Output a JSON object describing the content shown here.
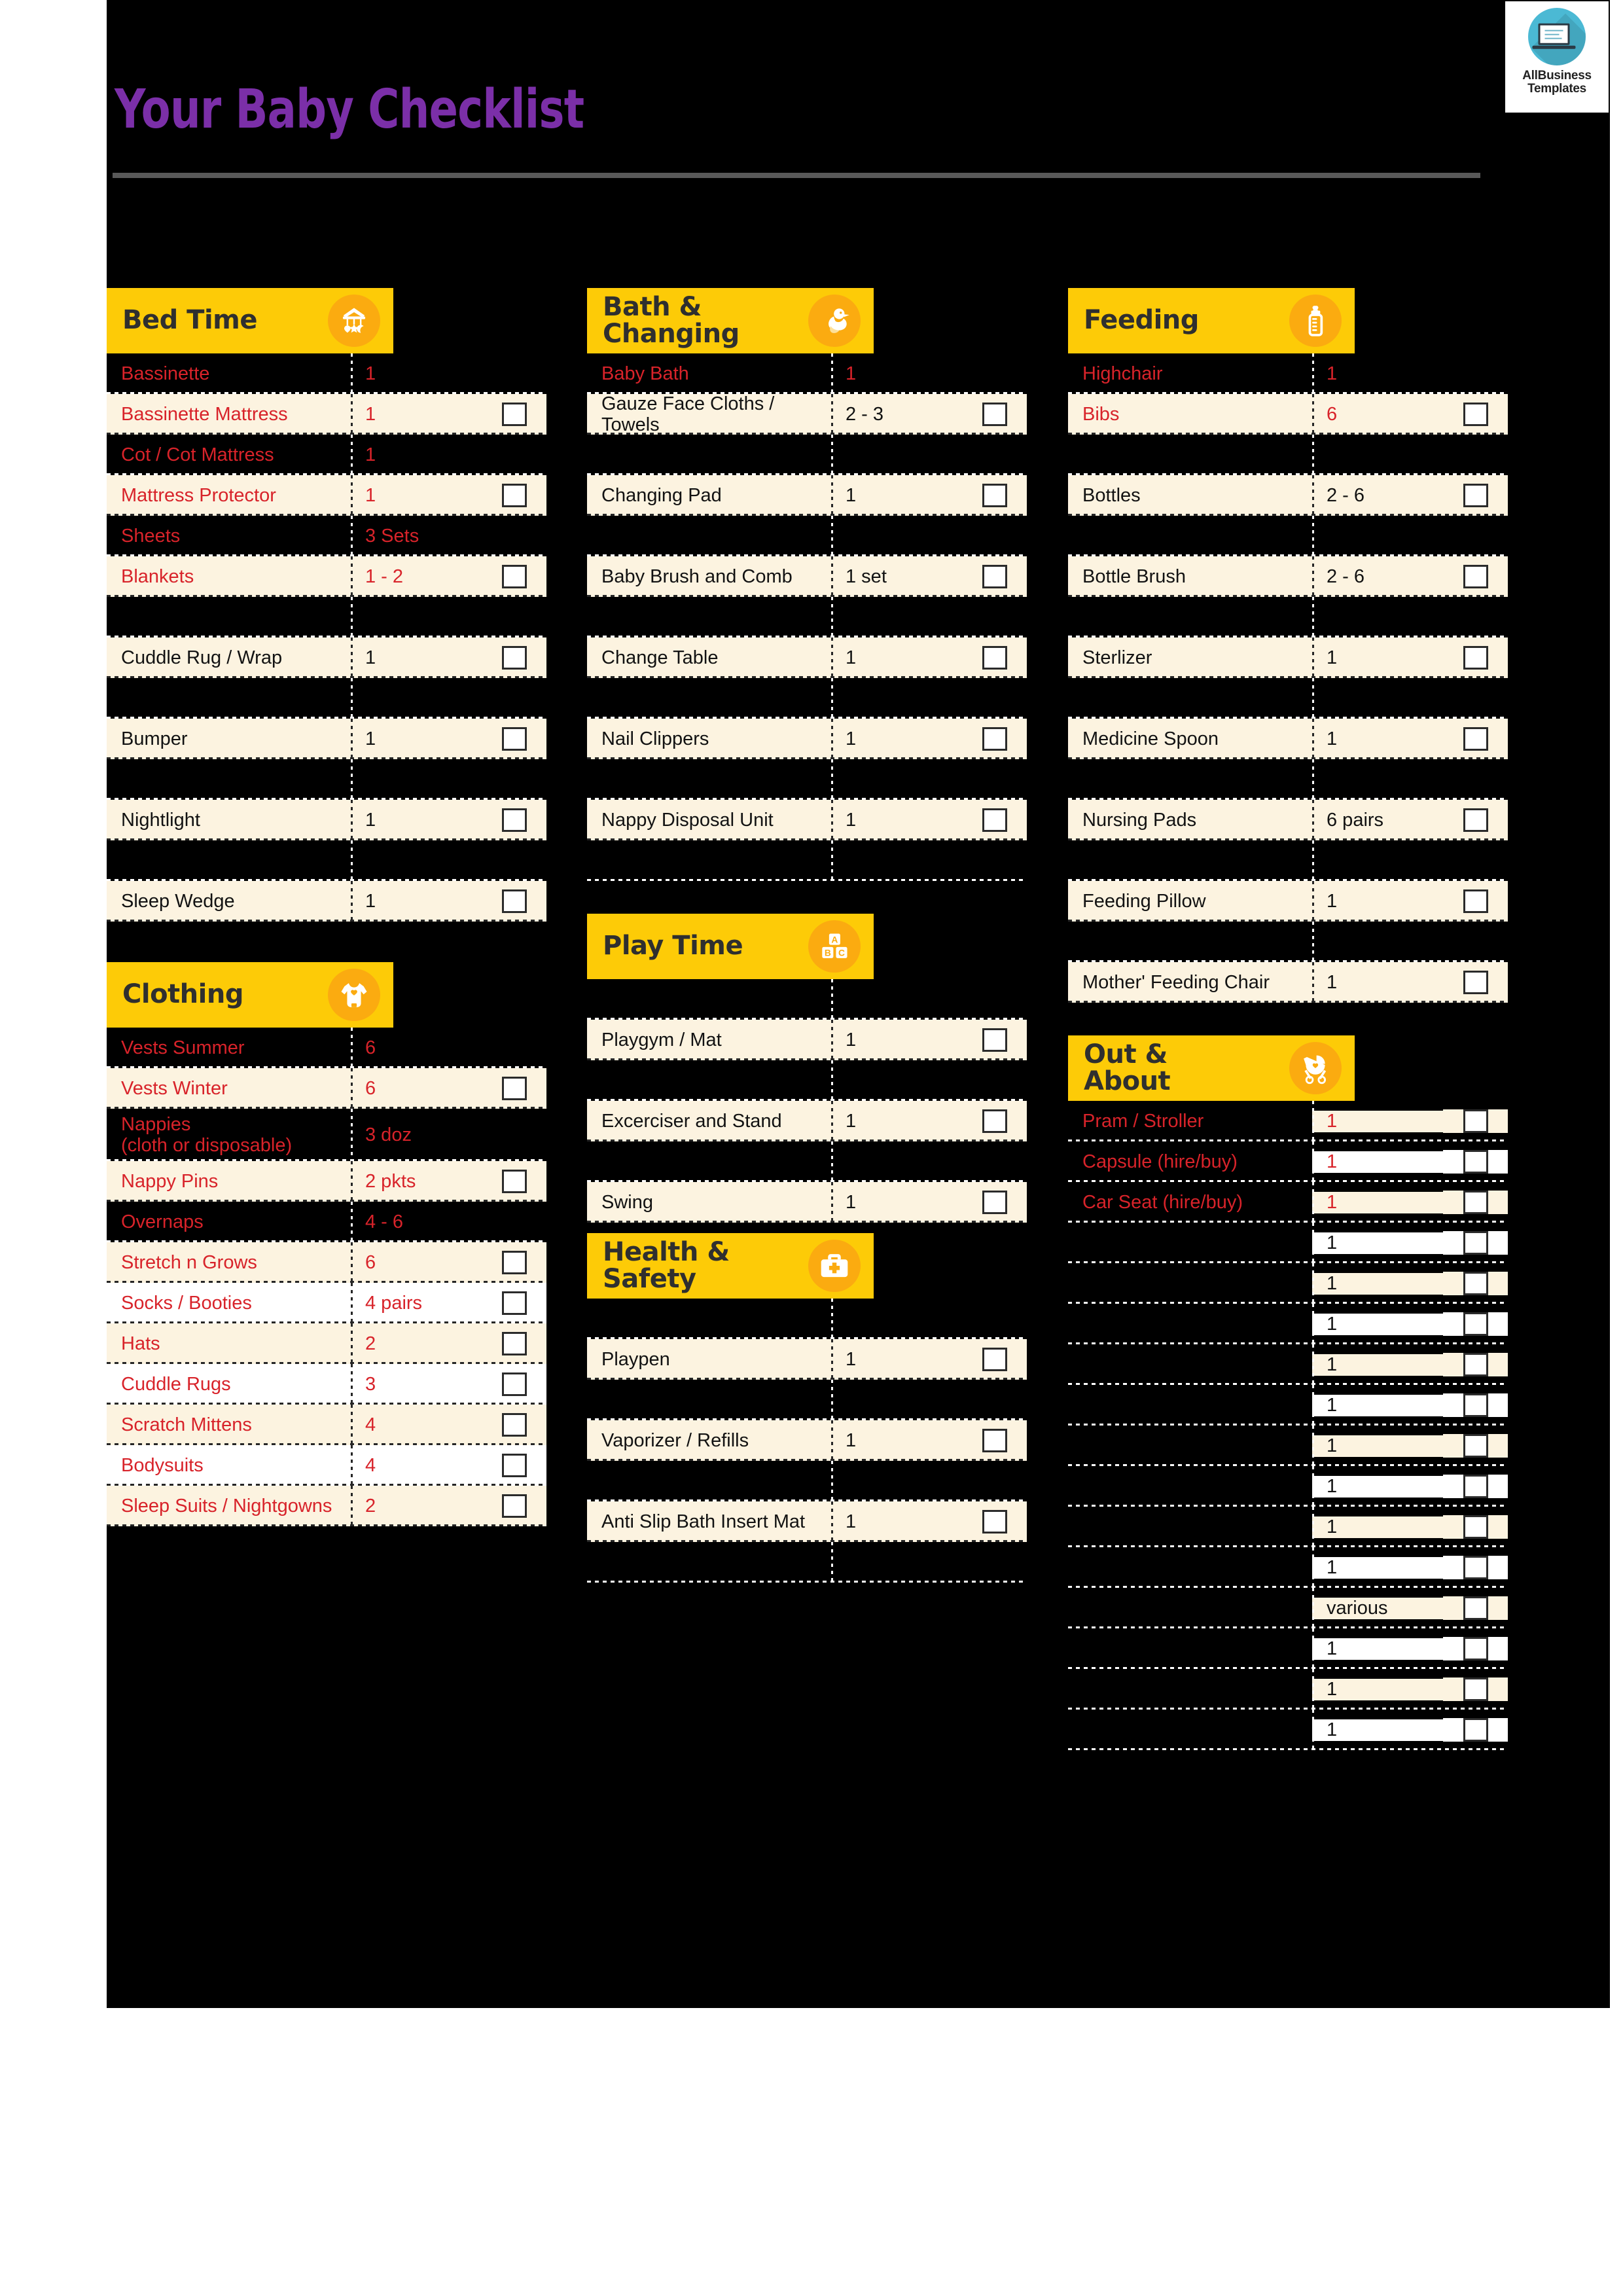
{
  "document": {
    "title": "Your Baby Checklist",
    "accent_yellow": "#FDCB07",
    "accent_icon_circle": "#FBAB10",
    "title_color": "#7B2FA8",
    "row_cream": "#FCF3E0",
    "row_white": "#FFFFFF",
    "text_red": "#D8232A",
    "text_black": "#121212",
    "background": "#000000"
  },
  "logo": {
    "line1": "AllBusiness",
    "line2": "Templates",
    "icon": "laptop-icon",
    "circle_color": "#4BB9D4"
  },
  "sections": [
    {
      "id": "bed-time",
      "title": "Bed Time",
      "icon": "baby-mobile-icon",
      "rows": [
        {
          "label": "Bassinette",
          "qty": "1",
          "style": "dark",
          "text": "red",
          "checkbox": false
        },
        {
          "label": "Bassinette Mattress",
          "qty": "1",
          "style": "cream",
          "text": "red",
          "checkbox": true
        },
        {
          "label": "Cot / Cot Mattress",
          "qty": "1",
          "style": "dark",
          "text": "red",
          "checkbox": false
        },
        {
          "label": "Mattress Protector",
          "qty": "1",
          "style": "cream",
          "text": "red",
          "checkbox": true
        },
        {
          "label": "Sheets",
          "qty": "3 Sets",
          "style": "dark",
          "text": "red",
          "checkbox": false
        },
        {
          "label": "Blankets",
          "qty": "1 - 2",
          "style": "cream",
          "text": "red",
          "checkbox": true
        },
        {
          "label": "",
          "qty": "",
          "style": "dark",
          "text": "red",
          "checkbox": false
        },
        {
          "label": "Cuddle Rug / Wrap",
          "qty": "1",
          "style": "cream",
          "text": "black",
          "checkbox": true
        },
        {
          "label": "",
          "qty": "",
          "style": "dark",
          "text": "black",
          "checkbox": false
        },
        {
          "label": "Bumper",
          "qty": "1",
          "style": "cream",
          "text": "black",
          "checkbox": true
        },
        {
          "label": "",
          "qty": "",
          "style": "dark",
          "text": "black",
          "checkbox": false
        },
        {
          "label": "Nightlight",
          "qty": "1",
          "style": "cream",
          "text": "black",
          "checkbox": true
        },
        {
          "label": "",
          "qty": "",
          "style": "dark",
          "text": "black",
          "checkbox": false
        },
        {
          "label": "Sleep Wedge",
          "qty": "1",
          "style": "cream",
          "text": "black",
          "checkbox": true
        }
      ]
    },
    {
      "id": "clothing",
      "title": "Clothing",
      "icon": "baby-onesie-icon",
      "rows": [
        {
          "label": "Vests Summer",
          "qty": "6",
          "style": "dark",
          "text": "red",
          "checkbox": false
        },
        {
          "label": "Vests Winter",
          "qty": "6",
          "style": "cream",
          "text": "red",
          "checkbox": true
        },
        {
          "label": "Nappies\n(cloth or disposable)",
          "qty": "3 doz",
          "style": "dark",
          "text": "red",
          "checkbox": false,
          "tall": true
        },
        {
          "label": "Nappy Pins",
          "qty": "2 pkts",
          "style": "cream",
          "text": "red",
          "checkbox": true
        },
        {
          "label": "Overnaps",
          "qty": "4 - 6",
          "style": "dark",
          "text": "red",
          "checkbox": false
        },
        {
          "label": "Stretch n Grows",
          "qty": "6",
          "style": "cream",
          "text": "red",
          "checkbox": true
        },
        {
          "label": "Socks / Booties",
          "qty": "4 pairs",
          "style": "white",
          "text": "red",
          "checkbox": true
        },
        {
          "label": "Hats",
          "qty": "2",
          "style": "cream",
          "text": "red",
          "checkbox": true
        },
        {
          "label": "Cuddle Rugs",
          "qty": "3",
          "style": "white",
          "text": "red",
          "checkbox": true
        },
        {
          "label": "Scratch Mittens",
          "qty": "4",
          "style": "cream",
          "text": "red",
          "checkbox": true
        },
        {
          "label": "Bodysuits",
          "qty": "4",
          "style": "white",
          "text": "red",
          "checkbox": true
        },
        {
          "label": "Sleep Suits / Nightgowns",
          "qty": "2",
          "style": "cream",
          "text": "red",
          "checkbox": true
        }
      ]
    },
    {
      "id": "bath-changing",
      "title": "Bath &\nChanging",
      "icon": "rubber-duck-icon",
      "rows": [
        {
          "label": "Baby Bath",
          "qty": "1",
          "style": "dark",
          "text": "red",
          "checkbox": false
        },
        {
          "label": "Gauze Face Cloths / Towels",
          "qty": "2 - 3",
          "style": "cream",
          "text": "black",
          "checkbox": true
        },
        {
          "label": "",
          "qty": "",
          "style": "dark",
          "text": "black",
          "checkbox": false
        },
        {
          "label": "Changing Pad",
          "qty": "1",
          "style": "cream",
          "text": "black",
          "checkbox": true
        },
        {
          "label": "",
          "qty": "",
          "style": "dark",
          "text": "black",
          "checkbox": false
        },
        {
          "label": "Baby Brush and Comb",
          "qty": "1 set",
          "style": "cream",
          "text": "black",
          "checkbox": true
        },
        {
          "label": "",
          "qty": "",
          "style": "dark",
          "text": "black",
          "checkbox": false
        },
        {
          "label": "Change Table",
          "qty": "1",
          "style": "cream",
          "text": "black",
          "checkbox": true
        },
        {
          "label": "",
          "qty": "",
          "style": "dark",
          "text": "black",
          "checkbox": false
        },
        {
          "label": "Nail Clippers",
          "qty": "1",
          "style": "cream",
          "text": "black",
          "checkbox": true
        },
        {
          "label": "",
          "qty": "",
          "style": "dark",
          "text": "black",
          "checkbox": false
        },
        {
          "label": "Nappy Disposal Unit",
          "qty": "1",
          "style": "cream",
          "text": "black",
          "checkbox": true
        },
        {
          "label": "",
          "qty": "",
          "style": "dark",
          "text": "black",
          "checkbox": false
        }
      ]
    },
    {
      "id": "play-time",
      "title": "Play Time",
      "icon": "abc-blocks-icon",
      "rows": [
        {
          "label": "",
          "qty": "",
          "style": "dark",
          "text": "black",
          "checkbox": false
        },
        {
          "label": "Playgym / Mat",
          "qty": "1",
          "style": "cream",
          "text": "black",
          "checkbox": true
        },
        {
          "label": "",
          "qty": "",
          "style": "dark",
          "text": "black",
          "checkbox": false
        },
        {
          "label": "Excerciser and Stand",
          "qty": "1",
          "style": "cream",
          "text": "black",
          "checkbox": true
        },
        {
          "label": "",
          "qty": "",
          "style": "dark",
          "text": "black",
          "checkbox": false
        },
        {
          "label": "Swing",
          "qty": "1",
          "style": "cream",
          "text": "black",
          "checkbox": true
        }
      ]
    },
    {
      "id": "health-safety",
      "title": "Health &\nSafety",
      "icon": "first-aid-kit-icon",
      "rows": [
        {
          "label": "",
          "qty": "",
          "style": "dark",
          "text": "black",
          "checkbox": false
        },
        {
          "label": "Playpen",
          "qty": "1",
          "style": "cream",
          "text": "black",
          "checkbox": true
        },
        {
          "label": "",
          "qty": "",
          "style": "dark",
          "text": "black",
          "checkbox": false
        },
        {
          "label": "Vaporizer / Refills",
          "qty": "1",
          "style": "cream",
          "text": "black",
          "checkbox": true
        },
        {
          "label": "",
          "qty": "",
          "style": "dark",
          "text": "black",
          "checkbox": false
        },
        {
          "label": "Anti Slip Bath Insert Mat",
          "qty": "1",
          "style": "cream",
          "text": "black",
          "checkbox": true
        },
        {
          "label": "",
          "qty": "",
          "style": "dark",
          "text": "black",
          "checkbox": false
        }
      ]
    },
    {
      "id": "feeding",
      "title": "Feeding",
      "icon": "baby-bottle-icon",
      "rows": [
        {
          "label": "Highchair",
          "qty": "1",
          "style": "dark",
          "text": "red",
          "checkbox": false
        },
        {
          "label": "Bibs",
          "qty": "6",
          "style": "cream",
          "text": "red",
          "checkbox": true
        },
        {
          "label": "",
          "qty": "",
          "style": "dark",
          "text": "black",
          "checkbox": false
        },
        {
          "label": "Bottles",
          "qty": "2 - 6",
          "style": "cream",
          "text": "black",
          "checkbox": true
        },
        {
          "label": "",
          "qty": "",
          "style": "dark",
          "text": "black",
          "checkbox": false
        },
        {
          "label": "Bottle Brush",
          "qty": "2 - 6",
          "style": "cream",
          "text": "black",
          "checkbox": true
        },
        {
          "label": "",
          "qty": "",
          "style": "dark",
          "text": "black",
          "checkbox": false
        },
        {
          "label": "Sterlizer",
          "qty": "1",
          "style": "cream",
          "text": "black",
          "checkbox": true
        },
        {
          "label": "",
          "qty": "",
          "style": "dark",
          "text": "black",
          "checkbox": false
        },
        {
          "label": "Medicine Spoon",
          "qty": "1",
          "style": "cream",
          "text": "black",
          "checkbox": true
        },
        {
          "label": "",
          "qty": "",
          "style": "dark",
          "text": "black",
          "checkbox": false
        },
        {
          "label": "Nursing Pads",
          "qty": "6 pairs",
          "style": "cream",
          "text": "black",
          "checkbox": true
        },
        {
          "label": "",
          "qty": "",
          "style": "dark",
          "text": "black",
          "checkbox": false
        },
        {
          "label": "Feeding Pillow",
          "qty": "1",
          "style": "cream",
          "text": "black",
          "checkbox": true
        },
        {
          "label": "",
          "qty": "",
          "style": "dark",
          "text": "black",
          "checkbox": false
        },
        {
          "label": "Mother' Feeding Chair",
          "qty": "1",
          "style": "cream",
          "text": "black",
          "checkbox": true
        }
      ]
    },
    {
      "id": "out-about",
      "title": "Out &\nAbout",
      "icon": "pram-stroller-icon",
      "split": true,
      "rows": [
        {
          "label": "Pram / Stroller",
          "qty": "1",
          "qty_style": "cream",
          "text": "red",
          "checkbox": true
        },
        {
          "label": "Capsule (hire/buy)",
          "qty": "1",
          "qty_style": "white",
          "text": "red",
          "checkbox": true
        },
        {
          "label": "Car Seat (hire/buy)",
          "qty": "1",
          "qty_style": "cream",
          "text": "red",
          "checkbox": true
        },
        {
          "label": "",
          "qty": "1",
          "qty_style": "white",
          "text": "black",
          "checkbox": true
        },
        {
          "label": "",
          "qty": "1",
          "qty_style": "cream",
          "text": "black",
          "checkbox": true
        },
        {
          "label": "",
          "qty": "1",
          "qty_style": "white",
          "text": "black",
          "checkbox": true
        },
        {
          "label": "",
          "qty": "1",
          "qty_style": "cream",
          "text": "black",
          "checkbox": true
        },
        {
          "label": "",
          "qty": "1",
          "qty_style": "white",
          "text": "black",
          "checkbox": true
        },
        {
          "label": "",
          "qty": "1",
          "qty_style": "cream",
          "text": "black",
          "checkbox": true
        },
        {
          "label": "",
          "qty": "1",
          "qty_style": "white",
          "text": "black",
          "checkbox": true
        },
        {
          "label": "",
          "qty": "1",
          "qty_style": "cream",
          "text": "black",
          "checkbox": true
        },
        {
          "label": "",
          "qty": "1",
          "qty_style": "white",
          "text": "black",
          "checkbox": true
        },
        {
          "label": "",
          "qty": "various",
          "qty_style": "cream",
          "text": "black",
          "checkbox": true
        },
        {
          "label": "",
          "qty": "1",
          "qty_style": "white",
          "text": "black",
          "checkbox": true
        },
        {
          "label": "",
          "qty": "1",
          "qty_style": "cream",
          "text": "black",
          "checkbox": true
        },
        {
          "label": "",
          "qty": "1",
          "qty_style": "white",
          "text": "black",
          "checkbox": true
        }
      ]
    }
  ]
}
